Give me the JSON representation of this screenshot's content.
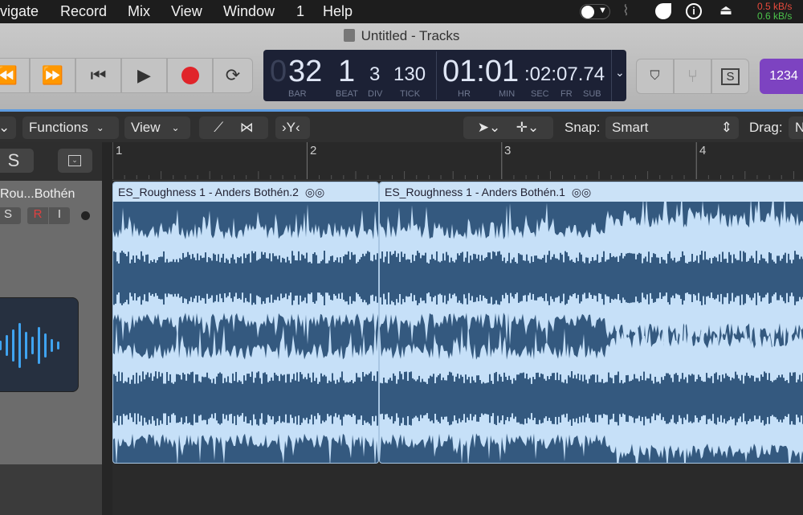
{
  "menubar": {
    "items": [
      "vigate",
      "Record",
      "Mix",
      "View",
      "Window",
      "1",
      "Help"
    ],
    "net_up": "0.5 kB/s",
    "net_down": "0.6 kB/s",
    "colors": {
      "up": "#e84a3c",
      "down": "#4bc24b"
    }
  },
  "window": {
    "title": "Untitled - Tracks"
  },
  "lcd": {
    "bar_lead": "0",
    "bar": "32",
    "beat": "1",
    "div": "3",
    "tick": "130",
    "hr_min": "01:01",
    "sec_fr_sub": ":02:07.74",
    "labels": {
      "bar": "BAR",
      "beat": "BEAT",
      "div": "DIV",
      "tick": "TICK",
      "hr": "HR",
      "min": "MIN",
      "sec": "SEC",
      "fr": "FR",
      "sub": "SUB"
    }
  },
  "right_buttons": {
    "solo": "S",
    "count_in": "1234"
  },
  "toolbar": {
    "functions": "Functions",
    "view": "View",
    "snap_label": "Snap:",
    "snap_value": "Smart",
    "drag_label": "Drag:",
    "drag_value": "N"
  },
  "track": {
    "solo_global": "S",
    "name": "Rou...Bothén",
    "solo": "S",
    "record": "R",
    "input": "I"
  },
  "ruler": [
    "1",
    "2",
    "3",
    "4"
  ],
  "regions": [
    {
      "name": "ES_Roughness 1 - Anders Bothén.2"
    },
    {
      "name": "ES_Roughness 1 - Anders Bothén.1"
    }
  ],
  "colors": {
    "region_body": "#34597f",
    "region_wave": "#c6e0f8",
    "accent_purple": "#7d43c1"
  }
}
